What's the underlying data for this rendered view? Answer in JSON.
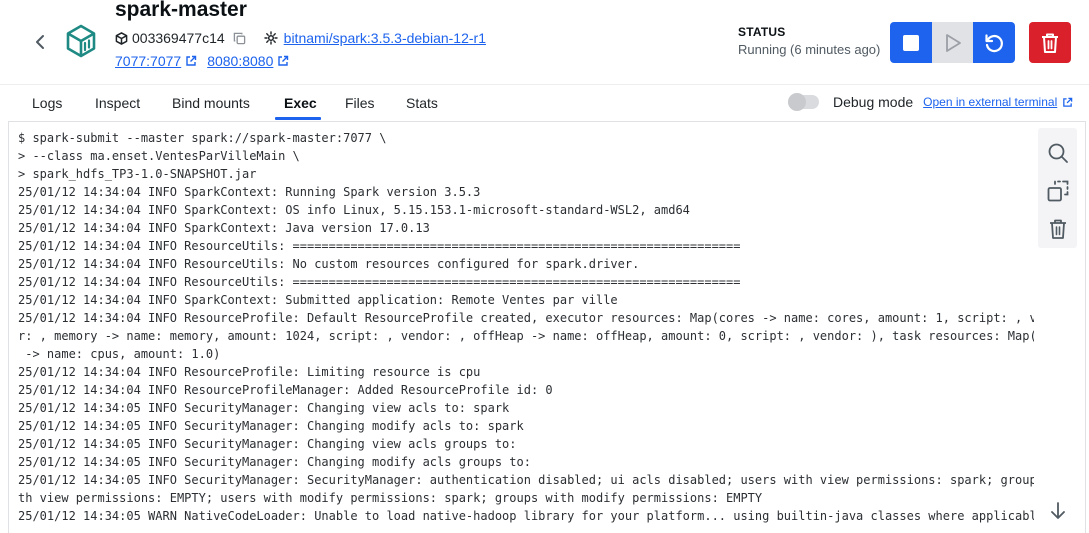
{
  "container": {
    "name": "spark-master",
    "id": "003369477c14",
    "image": "bitnami/spark:3.5.3-debian-12-r1",
    "ports": [
      "7077:7077",
      "8080:8080"
    ]
  },
  "status": {
    "label": "STATUS",
    "text": "Running (6 minutes ago)"
  },
  "colors": {
    "primary": "#1d63ed",
    "danger": "#d9202b",
    "teal": "#1f8a84",
    "disabled": "#e1e2e6"
  },
  "actions": {
    "stop": "stop-icon",
    "start": "play-icon",
    "restart": "restart-icon",
    "delete": "trash-icon"
  },
  "tabs": [
    {
      "label": "Logs",
      "active": false
    },
    {
      "label": "Inspect",
      "active": false
    },
    {
      "label": "Bind mounts",
      "active": false
    },
    {
      "label": "Exec",
      "active": true
    },
    {
      "label": "Files",
      "active": false
    },
    {
      "label": "Stats",
      "active": false
    }
  ],
  "debug": {
    "label": "Debug mode",
    "enabled": false,
    "external_link": "Open in external terminal"
  },
  "terminal": {
    "lines": [
      "$ spark-submit --master spark://spark-master:7077 \\",
      "> --class ma.enset.VentesParVilleMain \\",
      "> spark_hdfs_TP3-1.0-SNAPSHOT.jar",
      "25/01/12 14:34:04 INFO SparkContext: Running Spark version 3.5.3",
      "25/01/12 14:34:04 INFO SparkContext: OS info Linux, 5.15.153.1-microsoft-standard-WSL2, amd64",
      "25/01/12 14:34:04 INFO SparkContext: Java version 17.0.13",
      "25/01/12 14:34:04 INFO ResourceUtils: ==============================================================",
      "25/01/12 14:34:04 INFO ResourceUtils: No custom resources configured for spark.driver.",
      "25/01/12 14:34:04 INFO ResourceUtils: ==============================================================",
      "25/01/12 14:34:04 INFO SparkContext: Submitted application: Remote Ventes par ville",
      "25/01/12 14:34:04 INFO ResourceProfile: Default ResourceProfile created, executor resources: Map(cores -> name: cores, amount: 1, script: , vendo",
      "r: , memory -> name: memory, amount: 1024, script: , vendor: , offHeap -> name: offHeap, amount: 0, script: , vendor: ), task resources: Map(cpus",
      " -> name: cpus, amount: 1.0)",
      "25/01/12 14:34:04 INFO ResourceProfile: Limiting resource is cpu",
      "25/01/12 14:34:04 INFO ResourceProfileManager: Added ResourceProfile id: 0",
      "25/01/12 14:34:05 INFO SecurityManager: Changing view acls to: spark",
      "25/01/12 14:34:05 INFO SecurityManager: Changing modify acls to: spark",
      "25/01/12 14:34:05 INFO SecurityManager: Changing view acls groups to:",
      "25/01/12 14:34:05 INFO SecurityManager: Changing modify acls groups to:",
      "25/01/12 14:34:05 INFO SecurityManager: SecurityManager: authentication disabled; ui acls disabled; users with view permissions: spark; groups wi",
      "th view permissions: EMPTY; users with modify permissions: spark; groups with modify permissions: EMPTY",
      "25/01/12 14:34:05 WARN NativeCodeLoader: Unable to load native-hadoop library for your platform... using builtin-java classes where applicable"
    ],
    "tools": [
      "search-icon",
      "copy-icon",
      "trash-icon",
      "arrow-down-icon"
    ]
  }
}
